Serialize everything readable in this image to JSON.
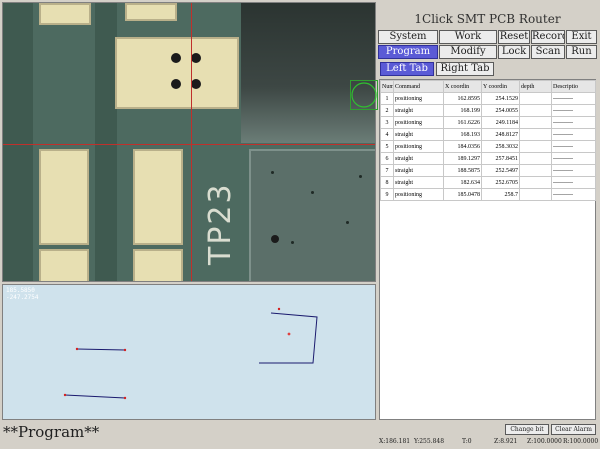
{
  "app_title": "1Click SMT PCB Router",
  "nav_row1": [
    "System",
    "Work",
    "Reset",
    "Record",
    "Exit"
  ],
  "nav_row2": [
    "Program",
    "Modify",
    "Lock",
    "Scan",
    "Run"
  ],
  "active_mode": "Program",
  "tabs": [
    "Left Tab",
    "Right Tab"
  ],
  "active_tab": "Left Tab",
  "table": {
    "headers": [
      "Numb",
      "Command",
      "X coordin",
      "Y coordin",
      "depth",
      "Descriptio"
    ],
    "rows": [
      [
        "1",
        "positioning",
        "162.8595",
        "254.1529",
        "",
        "----------"
      ],
      [
        "2",
        "straight",
        "168.199",
        "254.0055",
        "",
        "----------"
      ],
      [
        "3",
        "positioning",
        "161.6226",
        "249.1184",
        "",
        "----------"
      ],
      [
        "4",
        "straight",
        "168.193",
        "248.8127",
        "",
        "----------"
      ],
      [
        "5",
        "positioning",
        "184.0356",
        "258.3032",
        "",
        "----------"
      ],
      [
        "6",
        "straight",
        "189.1297",
        "257.8451",
        "",
        "----------"
      ],
      [
        "7",
        "straight",
        "188.5875",
        "252.5497",
        "",
        "----------"
      ],
      [
        "8",
        "straight",
        "182.634",
        "252.6705",
        "",
        "----------"
      ],
      [
        "9",
        "positioning",
        "185.0478",
        "258.7",
        "",
        "----------"
      ]
    ]
  },
  "camera": {
    "silkscreen_text": "TP23"
  },
  "path_view": {
    "coord_x": "185.5850",
    "coord_y": "-247.2754"
  },
  "mode_label": "**Program**",
  "buttons": {
    "change_bit": "Change bit",
    "clear_alarm": "Clear Alarm"
  },
  "status": {
    "x": "X:186.181",
    "y": "Y:255.848",
    "t": "T:0",
    "z": "Z:8.921",
    "zp": "Z:100.0000",
    "r": "R:100.0000"
  },
  "colors": {
    "accent": "#5b5bd6",
    "crosshair": "#c0302b",
    "path_line": "#1a1a6e",
    "path_point": "#d42020"
  }
}
